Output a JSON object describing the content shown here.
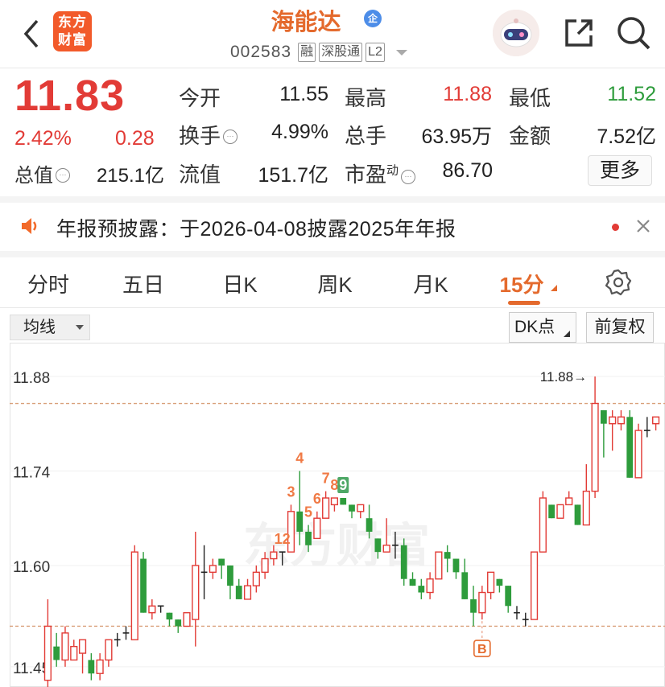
{
  "header": {
    "logo_line1": "东方",
    "logo_line2": "财富",
    "stock_name": "海能达",
    "badge": "企",
    "code": "002583",
    "tags": [
      "融",
      "深股通",
      "L2"
    ]
  },
  "quote": {
    "price": "11.83",
    "change_pct": "2.42%",
    "change": "0.28",
    "rows": [
      [
        {
          "label": "今开",
          "value": "11.55",
          "color": "normal"
        },
        {
          "label": "最高",
          "value": "11.88",
          "color": "red"
        },
        {
          "label": "最低",
          "value": "11.52",
          "color": "green"
        }
      ],
      [
        {
          "label": "换手",
          "value": "4.99%",
          "color": "normal"
        },
        {
          "label": "总手",
          "value": "63.95万",
          "color": "normal"
        },
        {
          "label": "金额",
          "value": "7.52亿",
          "color": "normal"
        }
      ]
    ],
    "market_cap_label": "总值",
    "market_cap": "215.1亿",
    "float_cap_label": "流值",
    "float_cap": "151.7亿",
    "pe_label": "市盈",
    "pe_sup": "动",
    "pe_value": "86.70",
    "more_label": "更多"
  },
  "notice": {
    "text": "年报预披露：于2026-04-08披露2025年年报"
  },
  "tabs": [
    "分时",
    "五日",
    "日K",
    "周K",
    "月K",
    "15分"
  ],
  "active_tab": "15分",
  "toolbar": {
    "ma_label": "均线",
    "dk_label": "DK点",
    "fq_label": "前复权"
  },
  "colors": {
    "up": "#e23b36",
    "down": "#2e9c3c",
    "accent": "#e46a2d"
  },
  "chart_data": {
    "type": "candlestick",
    "y_ticks": [
      "11.88",
      "11.74",
      "11.60",
      "11.45"
    ],
    "ylim": [
      11.42,
      11.93
    ],
    "max_label": "11.88→",
    "ref_lines": [
      11.84,
      11.51
    ],
    "watermark": "东方财富",
    "candles": [
      [
        11.43,
        11.51,
        11.4,
        11.55
      ],
      [
        11.48,
        11.46,
        11.45,
        11.5
      ],
      [
        11.46,
        11.5,
        11.45,
        11.51
      ],
      [
        11.46,
        11.48,
        11.46,
        11.49
      ],
      [
        11.47,
        11.49,
        11.44,
        11.49
      ],
      [
        11.46,
        11.44,
        11.43,
        11.47
      ],
      [
        11.44,
        11.46,
        11.43,
        11.47
      ],
      [
        11.46,
        11.49,
        11.45,
        11.49
      ],
      [
        11.49,
        11.49,
        11.48,
        11.5
      ],
      [
        11.5,
        11.5,
        11.49,
        11.51
      ],
      [
        11.49,
        11.62,
        11.49,
        11.63
      ],
      [
        11.61,
        11.53,
        11.53,
        11.62
      ],
      [
        11.53,
        11.54,
        11.52,
        11.55
      ],
      [
        11.54,
        11.54,
        11.53,
        11.54
      ],
      [
        11.53,
        11.52,
        11.51,
        11.53
      ],
      [
        11.52,
        11.51,
        11.5,
        11.52
      ],
      [
        11.51,
        11.53,
        11.51,
        11.53
      ],
      [
        11.52,
        11.6,
        11.48,
        11.65
      ],
      [
        11.59,
        11.59,
        11.55,
        11.63
      ],
      [
        11.59,
        11.6,
        11.58,
        11.61
      ],
      [
        11.61,
        11.6,
        11.58,
        11.61
      ],
      [
        11.6,
        11.57,
        11.55,
        11.6
      ],
      [
        11.57,
        11.55,
        11.55,
        11.58
      ],
      [
        11.55,
        11.57,
        11.55,
        11.58
      ],
      [
        11.57,
        11.59,
        11.56,
        11.6
      ],
      [
        11.59,
        11.61,
        11.58,
        11.62
      ],
      [
        11.61,
        11.62,
        11.6,
        11.63
      ],
      [
        11.62,
        11.62,
        11.6,
        11.62
      ],
      [
        11.62,
        11.68,
        11.62,
        11.69
      ],
      [
        11.68,
        11.65,
        11.63,
        11.74
      ],
      [
        11.65,
        11.63,
        11.62,
        11.66
      ],
      [
        11.64,
        11.67,
        11.64,
        11.68
      ],
      [
        11.67,
        11.7,
        11.67,
        11.71
      ],
      [
        11.69,
        11.7,
        11.68,
        11.7
      ],
      [
        11.7,
        11.69,
        11.69,
        11.7
      ],
      [
        11.69,
        11.68,
        11.67,
        11.69
      ],
      [
        11.68,
        11.69,
        11.67,
        11.69
      ],
      [
        11.67,
        11.65,
        11.64,
        11.69
      ],
      [
        11.64,
        11.62,
        11.61,
        11.64
      ],
      [
        11.62,
        11.63,
        11.62,
        11.67
      ],
      [
        11.63,
        11.63,
        11.61,
        11.65
      ],
      [
        11.63,
        11.58,
        11.57,
        11.64
      ],
      [
        11.58,
        11.57,
        11.57,
        11.59
      ],
      [
        11.57,
        11.56,
        11.55,
        11.58
      ],
      [
        11.56,
        11.58,
        11.55,
        11.59
      ],
      [
        11.58,
        11.62,
        11.58,
        11.62
      ],
      [
        11.62,
        11.61,
        11.59,
        11.63
      ],
      [
        11.61,
        11.59,
        11.58,
        11.61
      ],
      [
        11.59,
        11.55,
        11.55,
        11.61
      ],
      [
        11.55,
        11.53,
        11.51,
        11.57
      ],
      [
        11.53,
        11.56,
        11.52,
        11.57
      ],
      [
        11.56,
        11.59,
        11.55,
        11.59
      ],
      [
        11.58,
        11.57,
        11.56,
        11.58
      ],
      [
        11.57,
        11.54,
        11.53,
        11.57
      ],
      [
        11.53,
        11.53,
        11.52,
        11.54
      ],
      [
        11.52,
        11.52,
        11.51,
        11.53
      ],
      [
        11.52,
        11.62,
        11.52,
        11.62
      ],
      [
        11.62,
        11.7,
        11.62,
        11.71
      ],
      [
        11.69,
        11.67,
        11.67,
        11.69
      ],
      [
        11.67,
        11.69,
        11.67,
        11.69
      ],
      [
        11.69,
        11.7,
        11.69,
        11.71
      ],
      [
        11.69,
        11.66,
        11.66,
        11.69
      ],
      [
        11.66,
        11.71,
        11.66,
        11.75
      ],
      [
        11.71,
        11.84,
        11.7,
        11.88
      ],
      [
        11.83,
        11.81,
        11.76,
        11.83
      ],
      [
        11.81,
        11.82,
        11.77,
        11.83
      ],
      [
        11.81,
        11.82,
        11.8,
        11.83
      ],
      [
        11.82,
        11.73,
        11.73,
        11.83
      ],
      [
        11.73,
        11.8,
        11.73,
        11.81
      ],
      [
        11.8,
        11.8,
        11.79,
        11.82
      ],
      [
        11.81,
        11.82,
        11.8,
        11.82
      ]
    ],
    "markers": [
      {
        "text": "12",
        "index": 27
      },
      {
        "text": "3",
        "index": 28
      },
      {
        "text": "4",
        "index": 29
      },
      {
        "text": "5",
        "index": 30
      },
      {
        "text": "6",
        "index": 31
      },
      {
        "text": "7",
        "index": 32
      },
      {
        "text": "8",
        "index": 33
      },
      {
        "text": "9",
        "index": 34
      },
      {
        "text": "B",
        "index": 50
      }
    ]
  }
}
